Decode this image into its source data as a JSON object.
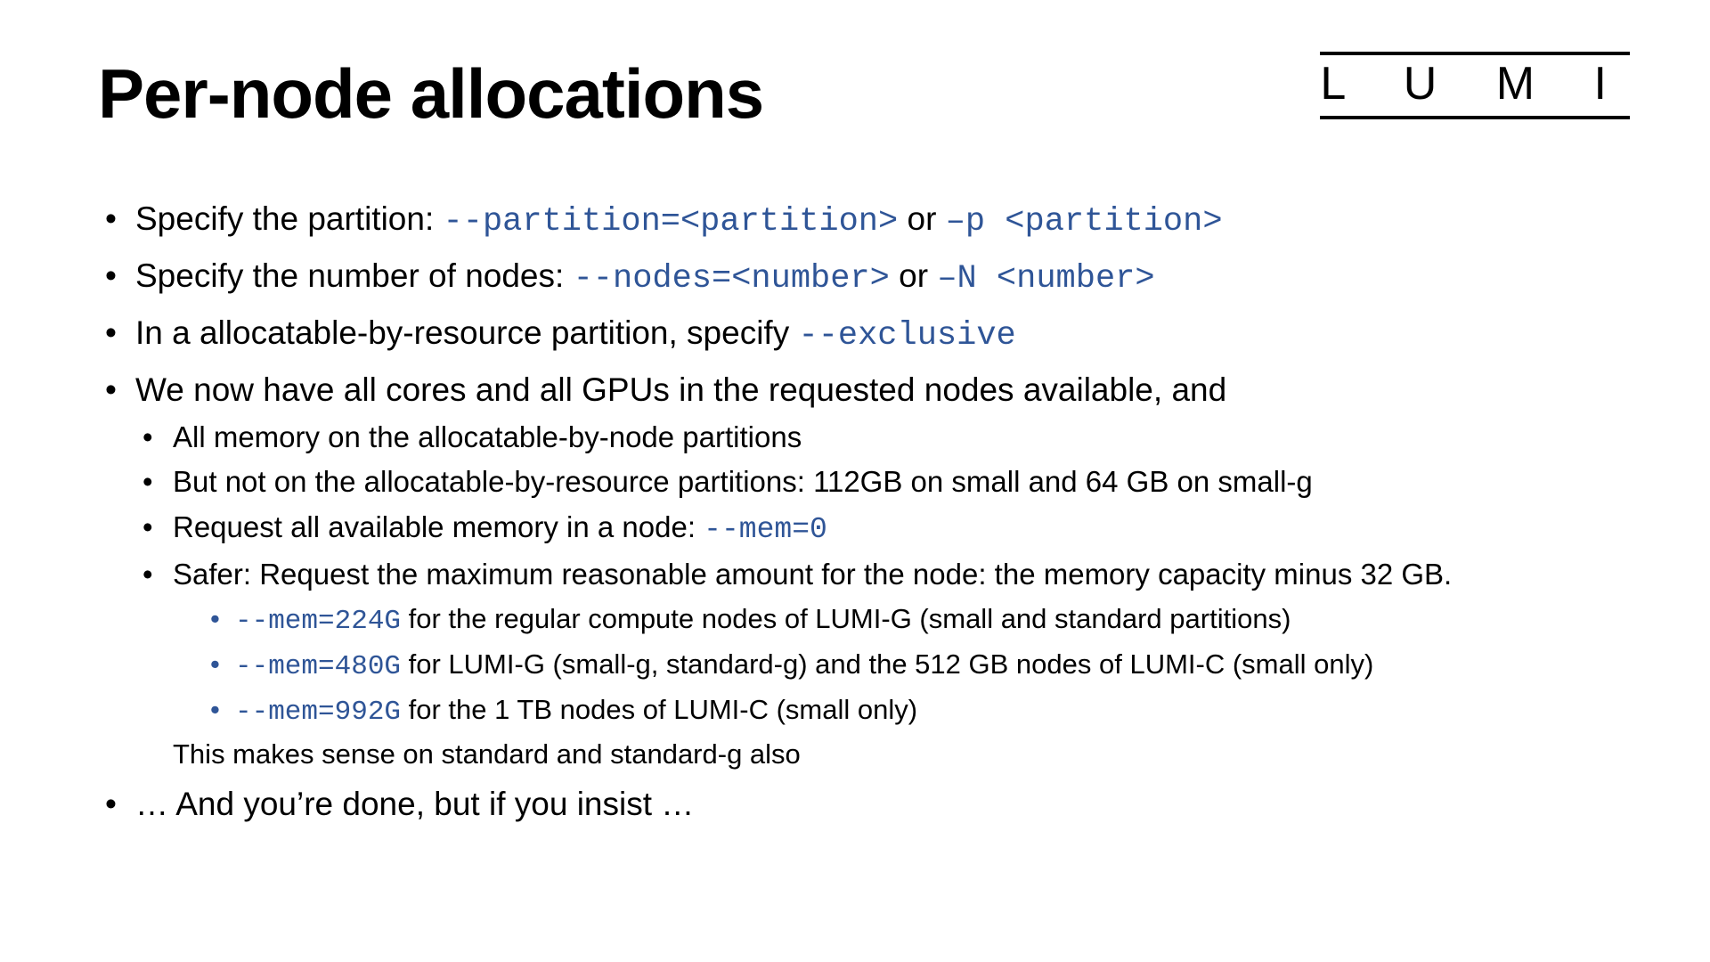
{
  "logo": "L U M I",
  "title": "Per-node allocations",
  "b1_pre": "Specify the partition: ",
  "b1_code1": "--partition=<partition>",
  "b1_mid": " or ",
  "b1_code2": "–p <partition>",
  "b2_pre": "Specify the number of nodes: ",
  "b2_code1": "--nodes=<number>",
  "b2_mid": " or ",
  "b2_code2": "–N <number>",
  "b3_pre": "In a allocatable-by-resource partition, specify ",
  "b3_code": "--exclusive",
  "b4": "We now have all cores and all GPUs in the requested nodes available, and",
  "b4s1": "All memory on the allocatable-by-node partitions",
  "b4s2": "But not on the allocatable-by-resource partitions: 112GB on small and 64 GB on small-g",
  "b4s3_pre": "Request all available memory in a node: ",
  "b4s3_code": "--mem=0",
  "b4s4": "Safer: Request the maximum reasonable amount for the node: the memory capacity minus 32 GB.",
  "b4s4a_code": "--mem=224G",
  "b4s4a_post": " for the regular compute nodes of LUMI-G (small and standard partitions)",
  "b4s4b_code": "--mem=480G",
  "b4s4b_post": " for LUMI-G (small-g, standard-g) and the 512 GB nodes of LUMI-C (small only)",
  "b4s4c_code": "--mem=992G",
  "b4s4c_post": " for the 1 TB nodes of LUMI-C (small only)",
  "b4s4_trail": "This makes sense on standard and standard-g also",
  "b5": "… And you’re done, but if you insist …"
}
